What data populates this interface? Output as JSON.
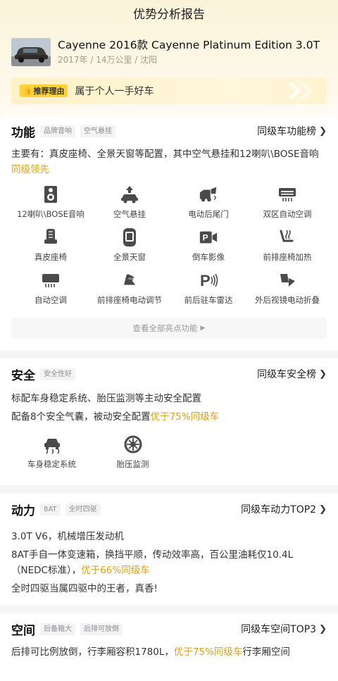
{
  "header": {
    "title": "优势分析报告"
  },
  "car": {
    "name": "Cayenne 2016款 Cayenne Platinum Edition 3.0T",
    "meta": "2017年 / 14万公里 / 沈阳"
  },
  "reason": {
    "tag": "推荐理由",
    "text": "属于个人一手好车"
  },
  "features": {
    "title": "功能",
    "chips": [
      "品牌音响",
      "空气悬挂"
    ],
    "rank": "同级车功能榜",
    "desc_main": "主要有：真皮座椅、全景天窗等配置，其中空气悬挂和12喇叭\\BOSE音响",
    "desc_highlight": "同级领先",
    "items": [
      {
        "label": "12喇叭\\BOSE音响",
        "icon": "speaker-icon"
      },
      {
        "label": "空气悬挂",
        "icon": "air-suspension-icon"
      },
      {
        "label": "电动后尾门",
        "icon": "power-tailgate-icon"
      },
      {
        "label": "双区自动空调",
        "icon": "dual-zone-ac-icon"
      },
      {
        "label": "真皮座椅",
        "icon": "leather-seat-icon"
      },
      {
        "label": "全景天窗",
        "icon": "panoramic-sunroof-icon"
      },
      {
        "label": "倒车影像",
        "icon": "reverse-camera-icon"
      },
      {
        "label": "前排座椅加热",
        "icon": "seat-heating-icon"
      },
      {
        "label": "自动空调",
        "icon": "auto-ac-icon"
      },
      {
        "label": "前排座椅电动调节",
        "icon": "power-seat-icon"
      },
      {
        "label": "前后驻车雷达",
        "icon": "parking-radar-icon"
      },
      {
        "label": "外后视镜电动折叠",
        "icon": "mirror-fold-icon"
      }
    ],
    "more": "查看全部亮点功能"
  },
  "safety": {
    "title": "安全",
    "chips": [
      "安全性好"
    ],
    "rank": "同级车安全榜",
    "line1": "标配车身稳定系统、胎压监测等主动安全配置",
    "line2_main": "配备8个安全气囊，被动安全配置",
    "line2_highlight": "优于75%同级车",
    "items": [
      {
        "label": "车身稳定系统",
        "icon": "stability-control-icon"
      },
      {
        "label": "胎压监测",
        "icon": "tire-pressure-icon"
      }
    ]
  },
  "power": {
    "title": "动力",
    "chips": [
      "8AT",
      "全时四驱"
    ],
    "rank": "同级车动力TOP2",
    "line1": "3.0T V6，机械增压发动机",
    "line2_main": "8AT手自一体变速箱，换挡平顺，传动效率高，百公里油耗仅10.4L（NEDC标准），",
    "line2_highlight": "优于66%同级车",
    "line3": "全时四驱当属四驱中的王者，真香!"
  },
  "space": {
    "title": "空间",
    "chips": [
      "后备箱大",
      "后排可放倒"
    ],
    "rank": "同级车空间TOP3",
    "line_main": "后排可比例放倒，行李厢容积1780L，",
    "line_highlight": "优于75%同级车",
    "line_tail": "行李厢空间"
  },
  "colors": {
    "accent": "#d9a11c",
    "tag_bg": "#ffd23a",
    "icon": "#4a4a4a"
  }
}
